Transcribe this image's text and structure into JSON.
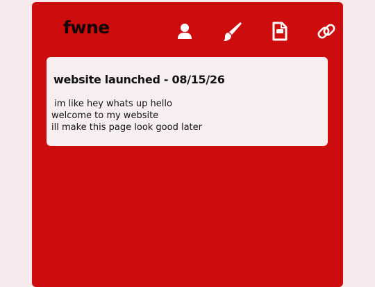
{
  "site": {
    "title": "fwne"
  },
  "nav": [
    {
      "name": "profile-icon"
    },
    {
      "name": "brush-icon"
    },
    {
      "name": "document-icon"
    },
    {
      "name": "link-icon"
    }
  ],
  "post": {
    "title": "website launched - 08/15/26",
    "lines": [
      " im like hey whats up hello",
      "welcome to my website",
      "ill make this page look good later"
    ]
  },
  "colors": {
    "background": "#f6e9eb",
    "panel": "#cc0c0d",
    "card": "#f6eef0",
    "icon": "#ffffff"
  }
}
